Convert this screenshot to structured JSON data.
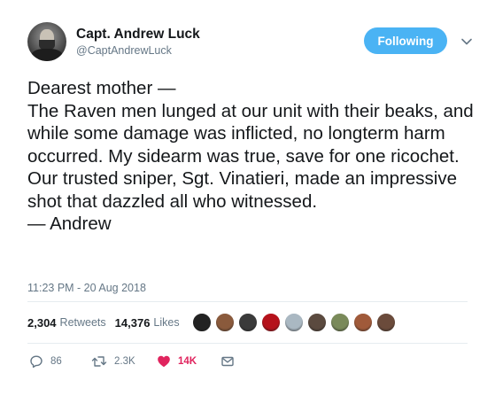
{
  "author": {
    "display_name": "Capt. Andrew Luck",
    "handle": "@CaptAndrewLuck"
  },
  "follow_button": {
    "label": "Following",
    "color": "#4ab3f4"
  },
  "tweet": {
    "text": "Dearest mother —\nThe Raven men lunged at our unit with their beaks, and while some damage was inflicted, no longterm harm occurred. My sidearm was true, save for one ricochet. Our trusted sniper, Sgt. Vinatieri, made an impressive shot that dazzled all who witnessed.\n— Andrew",
    "timestamp": "11:23 PM - 20 Aug 2018"
  },
  "stats": {
    "retweets_count": "2,304",
    "retweets_label": "Retweets",
    "likes_count": "14,376",
    "likes_label": "Likes"
  },
  "likers": [
    {
      "color": "#222222"
    },
    {
      "color": "#8a5a3c"
    },
    {
      "color": "#3a3a3a"
    },
    {
      "color": "#b5121b"
    },
    {
      "color": "#aab8c2"
    },
    {
      "color": "#5b4a3f"
    },
    {
      "color": "#7a8a5a"
    },
    {
      "color": "#a05a3a"
    },
    {
      "color": "#6b4b3b"
    }
  ],
  "actions": {
    "reply": {
      "icon": "reply-icon",
      "count": "86"
    },
    "retweet": {
      "icon": "retweet-icon",
      "count": "2.3K"
    },
    "like": {
      "icon": "heart-icon",
      "count": "14K",
      "color": "#e0245e"
    },
    "message": {
      "icon": "envelope-icon"
    }
  },
  "colors": {
    "secondary_text": "#657786",
    "primary_text": "#14171a",
    "accent": "#1da1f2"
  }
}
